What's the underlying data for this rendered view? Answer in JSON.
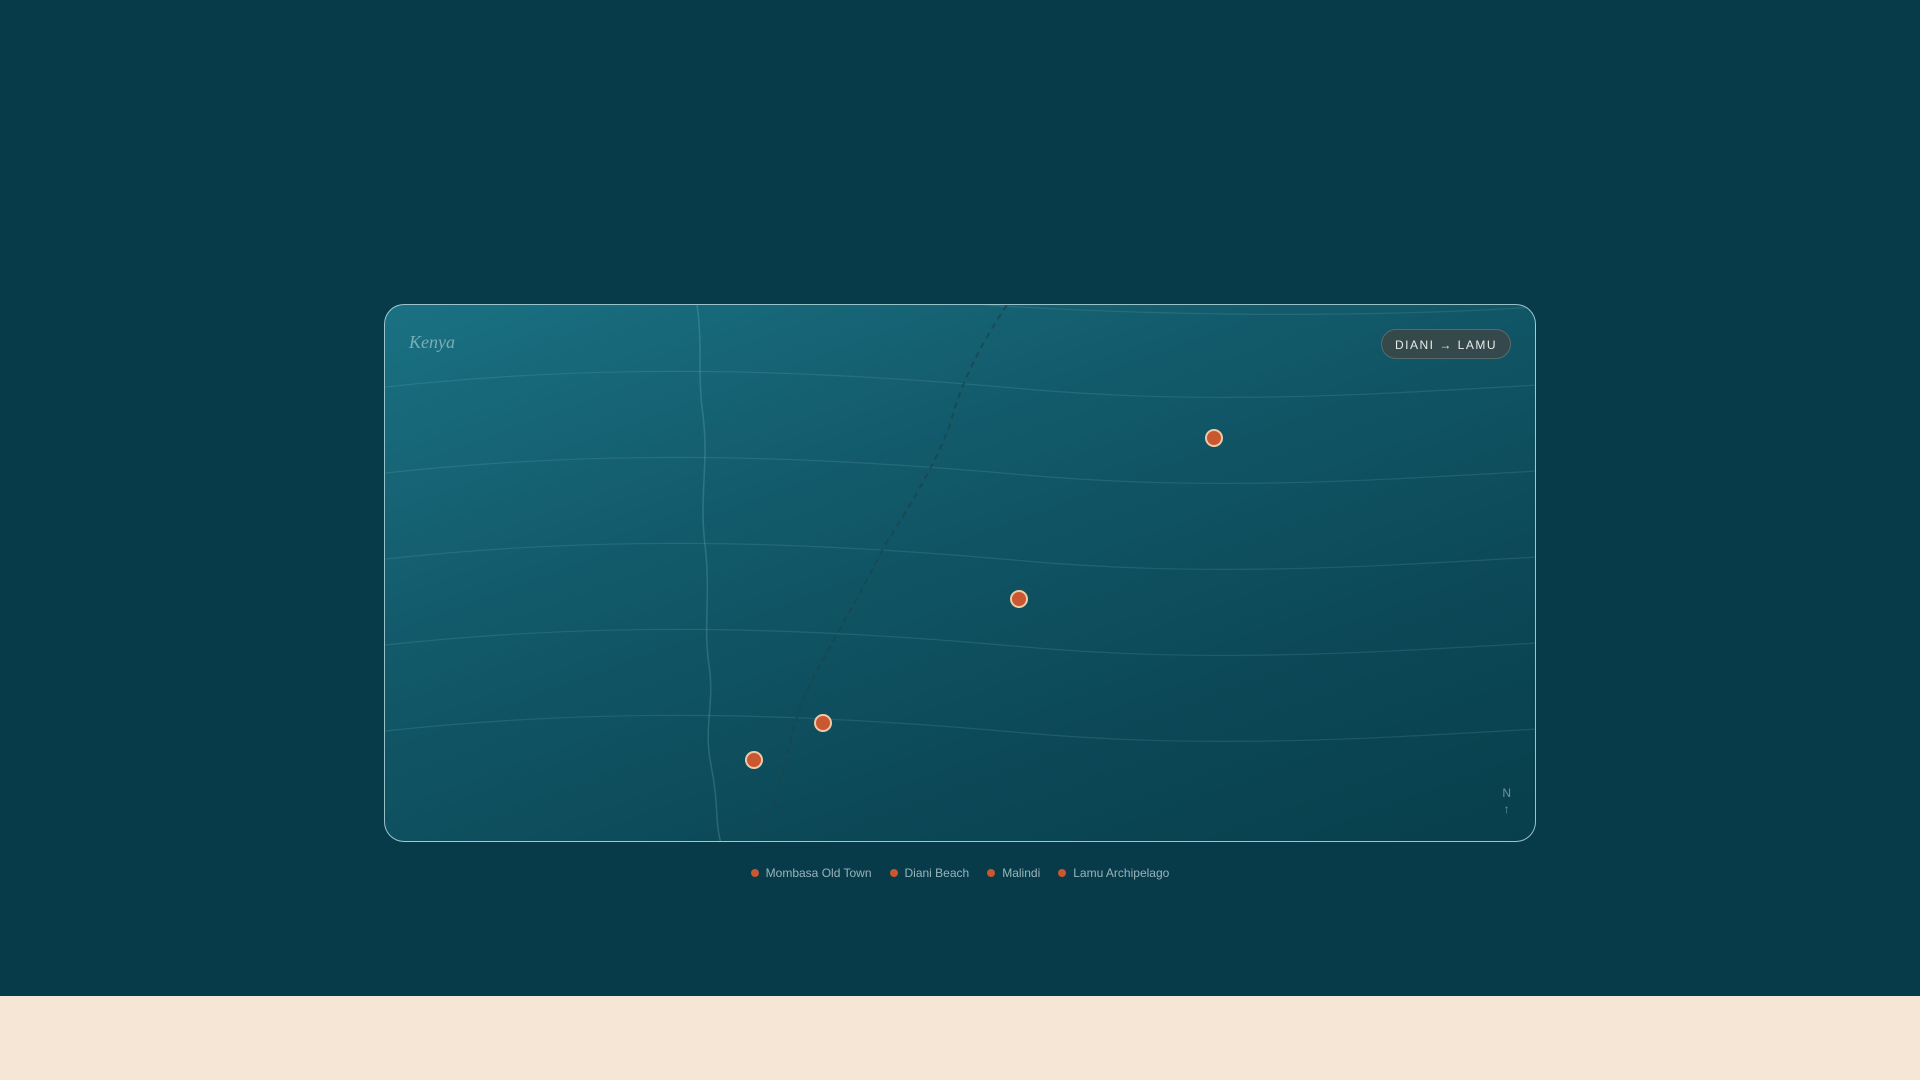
{
  "map": {
    "title": "Kenya",
    "route_badge": "DIANI → LAMU",
    "compass": {
      "letter": "N",
      "arrow": "↑"
    },
    "marker_color": "#c9572f",
    "locations": [
      {
        "name": "Mombasa Old Town"
      },
      {
        "name": "Diani Beach"
      },
      {
        "name": "Malindi"
      },
      {
        "name": "Lamu Archipelago"
      }
    ]
  },
  "legend": {
    "items": [
      {
        "label": "Mombasa Old Town"
      },
      {
        "label": "Diani Beach"
      },
      {
        "label": "Malindi"
      },
      {
        "label": "Lamu Archipelago"
      }
    ]
  }
}
